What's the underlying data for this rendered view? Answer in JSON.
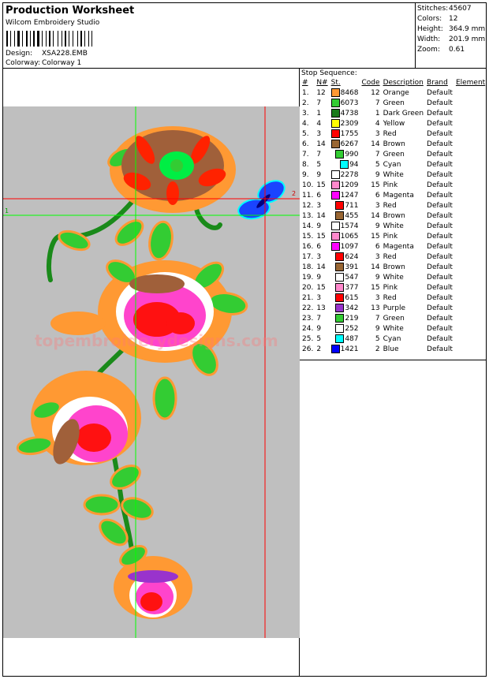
{
  "header": {
    "title": "Production Worksheet",
    "studio": "Wilcom Embroidery Studio",
    "design_label": "Design:",
    "design_value": "XSA228.EMB",
    "colorway_label": "Colorway:",
    "colorway_value": "Colorway 1"
  },
  "stats": {
    "stitches_label": "Stitches:",
    "stitches_value": "45607",
    "colors_label": "Colors:",
    "colors_value": "12",
    "height_label": "Height:",
    "height_value": "364.9 mm",
    "width_label": "Width:",
    "width_value": "201.9 mm",
    "zoom_label": "Zoom:",
    "zoom_value": "0.61"
  },
  "preview": {
    "watermark": "topembroiderydesigns.com",
    "guide_1": "1",
    "guide_2": "2"
  },
  "stop_sequence": {
    "title": "Stop Sequence:",
    "headers": [
      "#",
      "N#",
      "St.",
      "Code",
      "Description",
      "Brand",
      "Element"
    ],
    "rows": [
      {
        "idx": "1.",
        "n": "12",
        "color": "#ff9933",
        "st": "8468",
        "code": "12",
        "desc": "Orange",
        "brand": "Default"
      },
      {
        "idx": "2.",
        "n": "7",
        "color": "#33cc33",
        "st": "6073",
        "code": "7",
        "desc": "Green",
        "brand": "Default"
      },
      {
        "idx": "3.",
        "n": "1",
        "color": "#1a7a1a",
        "st": "4738",
        "code": "1",
        "desc": "Dark Green",
        "brand": "Default"
      },
      {
        "idx": "4.",
        "n": "4",
        "color": "#ffff00",
        "st": "2309",
        "code": "4",
        "desc": "Yellow",
        "brand": "Default"
      },
      {
        "idx": "5.",
        "n": "3",
        "color": "#ff0000",
        "st": "1755",
        "code": "3",
        "desc": "Red",
        "brand": "Default"
      },
      {
        "idx": "6.",
        "n": "14",
        "color": "#996633",
        "st": "6267",
        "code": "14",
        "desc": "Brown",
        "brand": "Default"
      },
      {
        "idx": "7.",
        "n": "7",
        "color": "#33cc33",
        "st": "990",
        "code": "7",
        "desc": "Green",
        "brand": "Default"
      },
      {
        "idx": "8.",
        "n": "5",
        "color": "#00ffff",
        "st": "94",
        "code": "5",
        "desc": "Cyan",
        "brand": "Default"
      },
      {
        "idx": "9.",
        "n": "9",
        "color": "#ffffff",
        "st": "2278",
        "code": "9",
        "desc": "White",
        "brand": "Default"
      },
      {
        "idx": "10.",
        "n": "15",
        "color": "#ff88cc",
        "st": "1209",
        "code": "15",
        "desc": "Pink",
        "brand": "Default"
      },
      {
        "idx": "11.",
        "n": "6",
        "color": "#ff00ff",
        "st": "1247",
        "code": "6",
        "desc": "Magenta",
        "brand": "Default"
      },
      {
        "idx": "12.",
        "n": "3",
        "color": "#ff0000",
        "st": "711",
        "code": "3",
        "desc": "Red",
        "brand": "Default"
      },
      {
        "idx": "13.",
        "n": "14",
        "color": "#996633",
        "st": "455",
        "code": "14",
        "desc": "Brown",
        "brand": "Default"
      },
      {
        "idx": "14.",
        "n": "9",
        "color": "#ffffff",
        "st": "1574",
        "code": "9",
        "desc": "White",
        "brand": "Default"
      },
      {
        "idx": "15.",
        "n": "15",
        "color": "#ff88cc",
        "st": "1065",
        "code": "15",
        "desc": "Pink",
        "brand": "Default"
      },
      {
        "idx": "16.",
        "n": "6",
        "color": "#ff00ff",
        "st": "1097",
        "code": "6",
        "desc": "Magenta",
        "brand": "Default"
      },
      {
        "idx": "17.",
        "n": "3",
        "color": "#ff0000",
        "st": "624",
        "code": "3",
        "desc": "Red",
        "brand": "Default"
      },
      {
        "idx": "18.",
        "n": "14",
        "color": "#996633",
        "st": "391",
        "code": "14",
        "desc": "Brown",
        "brand": "Default"
      },
      {
        "idx": "19.",
        "n": "9",
        "color": "#ffffff",
        "st": "547",
        "code": "9",
        "desc": "White",
        "brand": "Default"
      },
      {
        "idx": "20.",
        "n": "15",
        "color": "#ff88cc",
        "st": "377",
        "code": "15",
        "desc": "Pink",
        "brand": "Default"
      },
      {
        "idx": "21.",
        "n": "3",
        "color": "#ff0000",
        "st": "615",
        "code": "3",
        "desc": "Red",
        "brand": "Default"
      },
      {
        "idx": "22.",
        "n": "13",
        "color": "#9933cc",
        "st": "342",
        "code": "13",
        "desc": "Purple",
        "brand": "Default"
      },
      {
        "idx": "23.",
        "n": "7",
        "color": "#33cc33",
        "st": "219",
        "code": "7",
        "desc": "Green",
        "brand": "Default"
      },
      {
        "idx": "24.",
        "n": "9",
        "color": "#ffffff",
        "st": "252",
        "code": "9",
        "desc": "White",
        "brand": "Default"
      },
      {
        "idx": "25.",
        "n": "5",
        "color": "#00ffff",
        "st": "487",
        "code": "5",
        "desc": "Cyan",
        "brand": "Default"
      },
      {
        "idx": "26.",
        "n": "2",
        "color": "#0000ff",
        "st": "1421",
        "code": "2",
        "desc": "Blue",
        "brand": "Default"
      }
    ]
  }
}
